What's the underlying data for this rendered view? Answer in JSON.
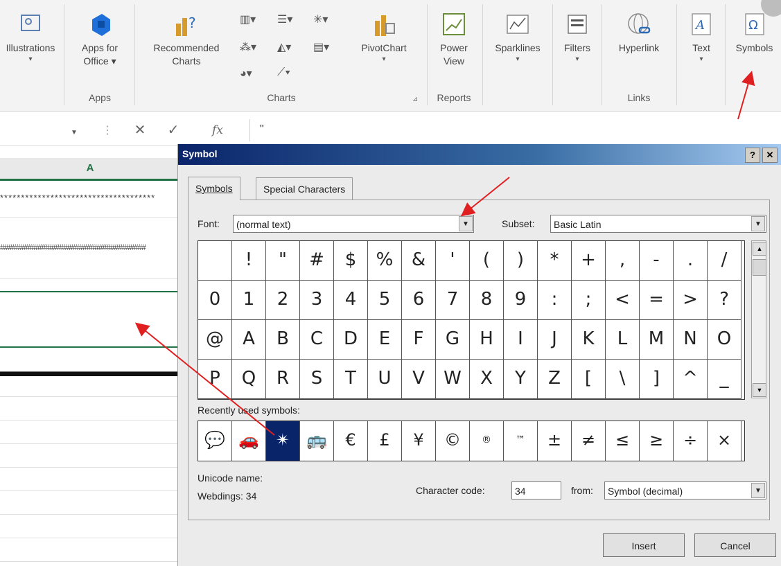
{
  "ribbon": {
    "buttons": [
      {
        "label": "Illustrations",
        "label2": "▾",
        "icon": "illustrations-icon"
      },
      {
        "label": "Apps for",
        "label2": "Office ▾",
        "icon": "office-store-icon"
      },
      {
        "label": "Recommended",
        "label2": "Charts",
        "icon": "recommended-charts-icon"
      },
      {
        "label": "PivotChart",
        "label2": "▾",
        "icon": "pivotchart-icon"
      },
      {
        "label": "Power",
        "label2": "View",
        "icon": "power-view-icon"
      },
      {
        "label": "Sparklines",
        "label2": "▾",
        "icon": "sparklines-icon"
      },
      {
        "label": "Filters",
        "label2": "▾",
        "icon": "filters-icon"
      },
      {
        "label": "Hyperlink",
        "label2": "",
        "icon": "hyperlink-icon"
      },
      {
        "label": "Text",
        "label2": "▾",
        "icon": "text-icon"
      },
      {
        "label": "Symbols",
        "label2": "",
        "icon": "symbols-icon"
      }
    ],
    "groups": {
      "apps": "Apps",
      "charts": "Charts",
      "reports": "Reports",
      "links": "Links"
    }
  },
  "formula_bar": {
    "cancel": "✕",
    "enter": "✓",
    "fx": "fx",
    "value": "\""
  },
  "sheet": {
    "column": "A",
    "rows": [
      "*************************************",
      "#####################################",
      "",
      "",
      "▬▬▬▬▬▬▬▬▬▬▬▬▬▬"
    ]
  },
  "dialog": {
    "title": "Symbol",
    "help_btn": "?",
    "close_btn": "✕",
    "tabs": [
      "Symbols",
      "Special Characters"
    ],
    "font_label": "Font:",
    "font_value": "(normal text)",
    "subset_label": "Subset:",
    "subset_value": "Basic Latin",
    "symbols": [
      "",
      "!",
      "\"",
      "#",
      "$",
      "%",
      "&",
      "'",
      "(",
      ")",
      "*",
      "+",
      ",",
      "-",
      ".",
      "/",
      "0",
      "1",
      "2",
      "3",
      "4",
      "5",
      "6",
      "7",
      "8",
      "9",
      ":",
      ";",
      "<",
      "=",
      ">",
      "?",
      "@",
      "A",
      "B",
      "C",
      "D",
      "E",
      "F",
      "G",
      "H",
      "I",
      "J",
      "K",
      "L",
      "M",
      "N",
      "O",
      "P",
      "Q",
      "R",
      "S",
      "T",
      "U",
      "V",
      "W",
      "X",
      "Y",
      "Z",
      "[",
      "\\",
      "]",
      "^",
      "_"
    ],
    "recent_label": "Recently used symbols:",
    "recent": [
      "💬",
      "🚗",
      "✴",
      "🚌",
      "€",
      "£",
      "¥",
      "©",
      "®",
      "™",
      "±",
      "≠",
      "≤",
      "≥",
      "÷",
      "×"
    ],
    "recent_selected": 2,
    "unicode_name_label": "Unicode name:",
    "unicode_name_value": "Webdings: 34",
    "char_code_label": "Character code:",
    "char_code_value": "34",
    "from_label": "from:",
    "from_value": "Symbol (decimal)",
    "insert_btn": "Insert",
    "cancel_btn": "Cancel"
  },
  "colors": {
    "excel_green": "#217346",
    "title_blue": "#0a246a",
    "arrow_red": "#e02020"
  }
}
